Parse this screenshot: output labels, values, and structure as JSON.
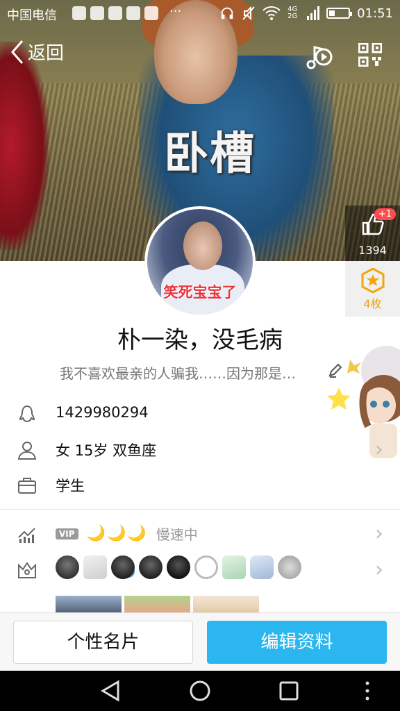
{
  "status_bar": {
    "carrier": "中国电信",
    "overflow": "···",
    "network": "4G 2G",
    "battery_level": 0.3,
    "time": "01:51"
  },
  "nav": {
    "back_label": "返回",
    "music_icon": "music-play-icon",
    "qr_icon": "qr-code-icon"
  },
  "cover": {
    "caption": "卧槽"
  },
  "likes": {
    "plus": "+1",
    "count": "1394"
  },
  "medal": {
    "label": "4枚"
  },
  "avatar": {
    "overlay_text": "笑死宝宝了"
  },
  "profile": {
    "nickname": "朴一染，没毛病",
    "signature": "我不喜欢最亲的人骗我……因为那是…"
  },
  "info": {
    "qq_number": "1429980294",
    "basic": "女  15岁  双鱼座",
    "occupation": "学生"
  },
  "vip": {
    "tag": "VIP",
    "moons": "🌙🌙🌙",
    "status": "慢速中"
  },
  "badges": [
    "qq-penguin-badge",
    "diamond-badge",
    "penguin-star-badge",
    "penguin-lightning-badge",
    "penguin-crown-badge",
    "cloud-badge",
    "green-diamond-badge",
    "star-badge",
    "lightning-badge"
  ],
  "buttons": {
    "card": "个性名片",
    "edit": "编辑资料"
  },
  "colors": {
    "accent": "#2bb6f0",
    "medal": "#f2a50f",
    "like_badge": "#ff4d4f"
  }
}
